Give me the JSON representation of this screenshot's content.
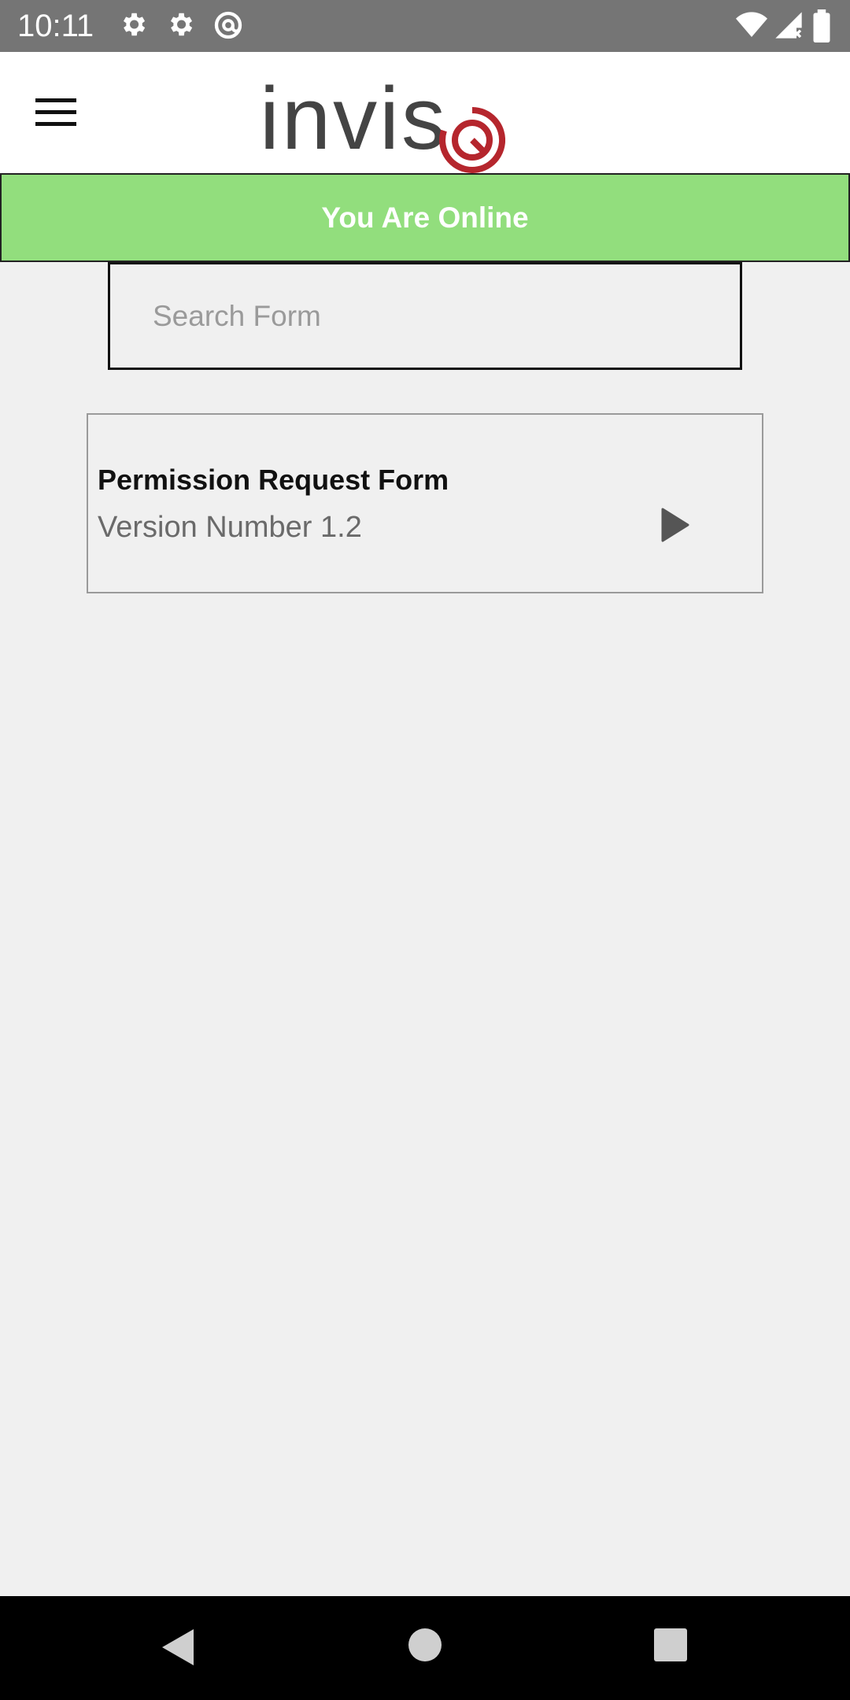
{
  "status_bar": {
    "time": "10:11",
    "icons": [
      "gear-icon",
      "gear-icon",
      "at-sign-icon",
      "wifi-icon",
      "signal-icon",
      "battery-icon"
    ]
  },
  "app_bar": {
    "logo_text": "invis",
    "logo_accent_color": "#b5262d",
    "menu_icon": "hamburger-icon"
  },
  "banner": {
    "text": "You Are Online",
    "color": "#92de7d"
  },
  "search": {
    "placeholder": "Search Form",
    "value": ""
  },
  "forms": [
    {
      "title": "Permission Request Form",
      "version": "Version Number 1.2",
      "action_icon": "play-icon"
    }
  ],
  "nav_bar": {
    "icons": [
      "back-icon",
      "home-icon",
      "recents-icon"
    ]
  }
}
